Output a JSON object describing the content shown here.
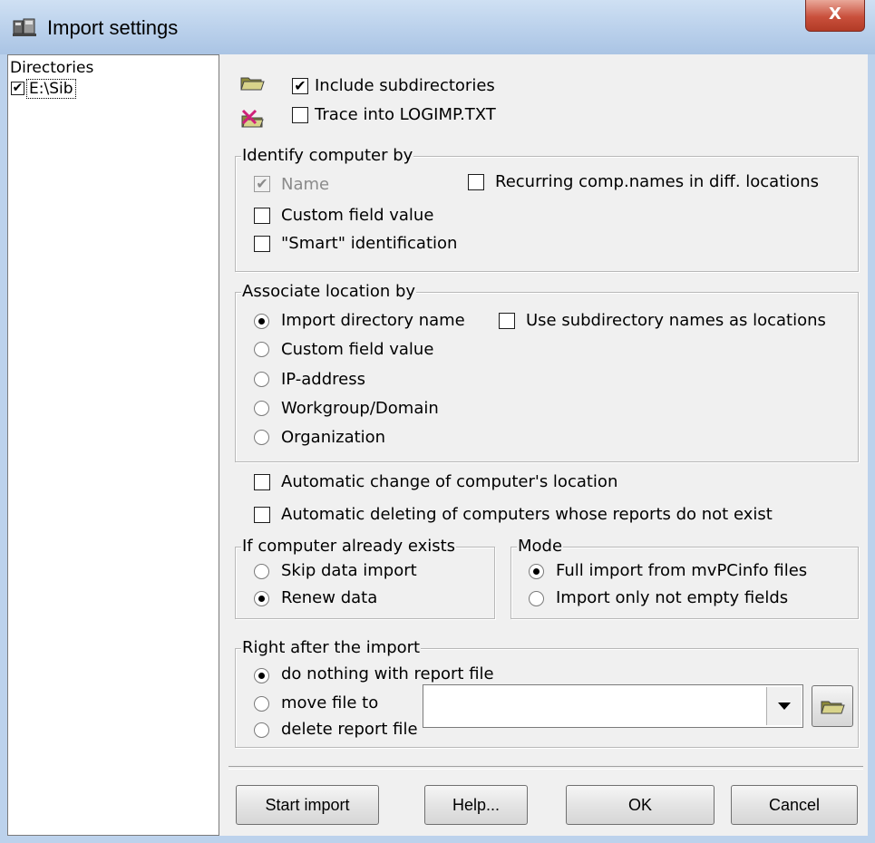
{
  "window": {
    "title": "Import settings",
    "close_label": "X"
  },
  "directories": {
    "header": "Directories",
    "items": [
      {
        "label": "E:\\Sib",
        "checked": true
      }
    ]
  },
  "options": {
    "include_subdirectories": "Include subdirectories",
    "trace_into": "Trace into LOGIMP.TXT"
  },
  "identify": {
    "title": "Identify computer by",
    "name": "Name",
    "custom_field": "Custom field value",
    "smart": "\"Smart\" identification",
    "recurring": "Recurring comp.names in diff. locations"
  },
  "associate": {
    "title": "Associate location by",
    "import_dir": "Import directory name",
    "custom_field": "Custom field value",
    "ip": "IP-address",
    "workgroup": "Workgroup/Domain",
    "organization": "Organization",
    "use_subdir": "Use subdirectory names as locations",
    "selected": "Import directory name"
  },
  "auto": {
    "change_location": "Automatic change of computer's location",
    "delete_computers": "Automatic deleting of computers whose reports do not exist"
  },
  "exists": {
    "title": "If computer already exists",
    "skip": "Skip data import",
    "renew": "Renew data",
    "selected": "Renew data"
  },
  "mode": {
    "title": "Mode",
    "full": "Full import from mvPCinfo files",
    "not_empty": "Import only not empty fields",
    "selected": "Full import from mvPCinfo files"
  },
  "after_import": {
    "title": "Right after the import",
    "do_nothing": "do nothing with report file",
    "move": "move file to",
    "delete": "delete report file",
    "selected": "do nothing with report file",
    "move_path": ""
  },
  "buttons": {
    "start": "Start import",
    "help": "Help...",
    "ok": "OK",
    "cancel": "Cancel"
  },
  "icons": {
    "open_folder": "open-folder-icon",
    "delete_folder": "folder-delete-icon",
    "app": "app-icon"
  },
  "colors": {
    "titlebar": "#bcd2ec",
    "close": "#c9503c"
  }
}
